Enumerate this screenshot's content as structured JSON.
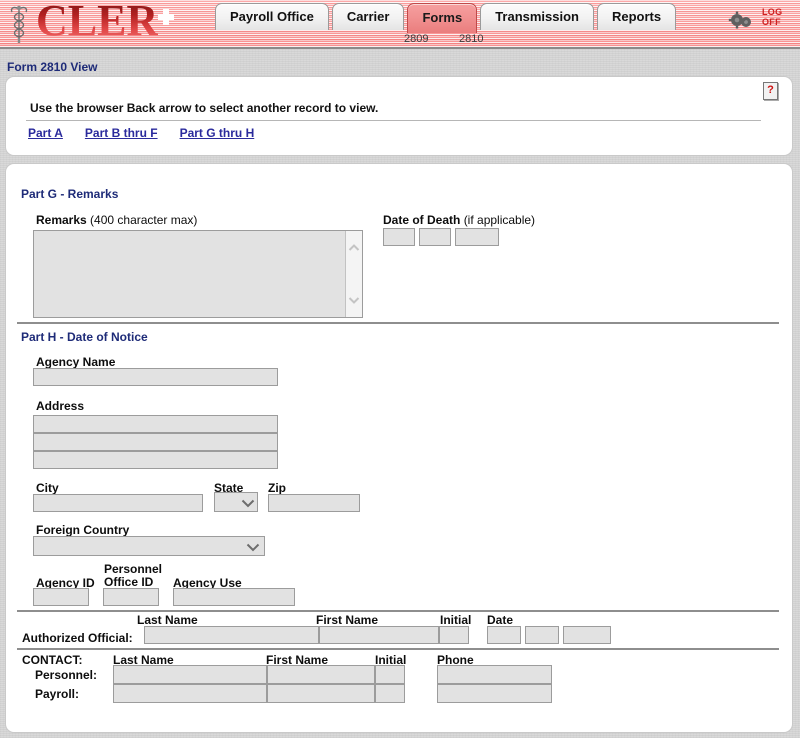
{
  "header": {
    "logo_text": "CLER",
    "logo_icon": "caduceus-icon",
    "gears_icon": "gears-icon",
    "logoff_line1": "LOG",
    "logoff_line2": "OFF",
    "tabs": [
      {
        "label": "Payroll Office",
        "active": false
      },
      {
        "label": "Carrier",
        "active": false
      },
      {
        "label": "Forms",
        "active": true
      },
      {
        "label": "Transmission",
        "active": false
      },
      {
        "label": "Reports",
        "active": false
      }
    ],
    "subtabs": [
      {
        "label": "2809"
      },
      {
        "label": "2810"
      }
    ]
  },
  "title_bar": {
    "page_title": "Form 2810 View"
  },
  "top_panel": {
    "instruction": "Use the browser Back arrow to select another record to view.",
    "part_links": [
      {
        "label": "Part A"
      },
      {
        "label": "Part B thru F"
      },
      {
        "label": "Part G thru H"
      }
    ],
    "help_icon_label": "?"
  },
  "part_g": {
    "heading": "Part G - Remarks",
    "remarks_label": "Remarks",
    "remarks_hint": "(400 character max)",
    "remarks_value": "",
    "date_of_death_label": "Date of Death",
    "date_of_death_hint": "(if applicable)",
    "dod_month": "",
    "dod_day": "",
    "dod_year": ""
  },
  "part_h": {
    "heading": "Part H - Date of Notice",
    "agency_name_label": "Agency Name",
    "agency_name_value": "",
    "address_label": "Address",
    "address_line1": "",
    "address_line2": "",
    "address_line3": "",
    "city_label": "City",
    "city_value": "",
    "state_label": "State",
    "state_value": "",
    "zip_label": "Zip",
    "zip_value": "",
    "foreign_country_label": "Foreign Country",
    "foreign_country_value": "",
    "agency_id_label": "Agency ID",
    "agency_id_value": "",
    "personnel_office_id_label_line1": "Personnel",
    "personnel_office_id_label_line2": "Office ID",
    "personnel_office_id_value": "",
    "agency_use_label": "Agency Use",
    "agency_use_value": ""
  },
  "authorized_official": {
    "row_label": "Authorized Official:",
    "last_name_label": "Last Name",
    "first_name_label": "First Name",
    "initial_label": "Initial",
    "date_label": "Date",
    "last_name_value": "",
    "first_name_value": "",
    "initial_value": "",
    "date_month": "",
    "date_day": "",
    "date_year": ""
  },
  "contact": {
    "section_label": "CONTACT:",
    "last_name_label": "Last Name",
    "first_name_label": "First Name",
    "initial_label": "Initial",
    "phone_label": "Phone",
    "rows": [
      {
        "label": "Personnel:",
        "last_name": "",
        "first_name": "",
        "initial": "",
        "phone": ""
      },
      {
        "label": "Payroll:",
        "last_name": "",
        "first_name": "",
        "initial": "",
        "phone": ""
      }
    ]
  },
  "colors": {
    "banner": "#f2a0a0",
    "active_tab": "#f08e8e",
    "heading_blue": "#1e2b78",
    "link_blue": "#2a2a9c",
    "field_gray": "#e2e2e2",
    "logoff_red": "#cc2222"
  }
}
